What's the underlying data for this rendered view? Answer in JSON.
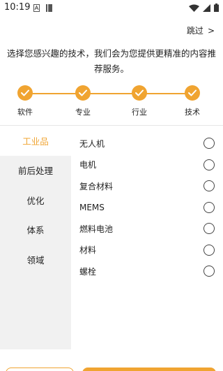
{
  "status": {
    "time": "10:19"
  },
  "skip": {
    "label": "跳过",
    "arrow": ">"
  },
  "intro": {
    "text": "选择您感兴趣的技术，我们会为您提供更精准的内容推荐服务。"
  },
  "steps": [
    {
      "label": "软件"
    },
    {
      "label": "专业"
    },
    {
      "label": "行业"
    },
    {
      "label": "技术"
    }
  ],
  "categories": [
    {
      "label": "工业品",
      "active": true
    },
    {
      "label": "前后处理"
    },
    {
      "label": "优化"
    },
    {
      "label": "体系"
    },
    {
      "label": "领域"
    }
  ],
  "options": [
    {
      "label": "无人机"
    },
    {
      "label": "电机"
    },
    {
      "label": "复合材料"
    },
    {
      "label": "MEMS"
    },
    {
      "label": "燃料电池"
    },
    {
      "label": "材料"
    },
    {
      "label": "螺栓"
    }
  ],
  "colors": {
    "accent": "#f0a431",
    "nav_bg": "#f1f1f1"
  }
}
